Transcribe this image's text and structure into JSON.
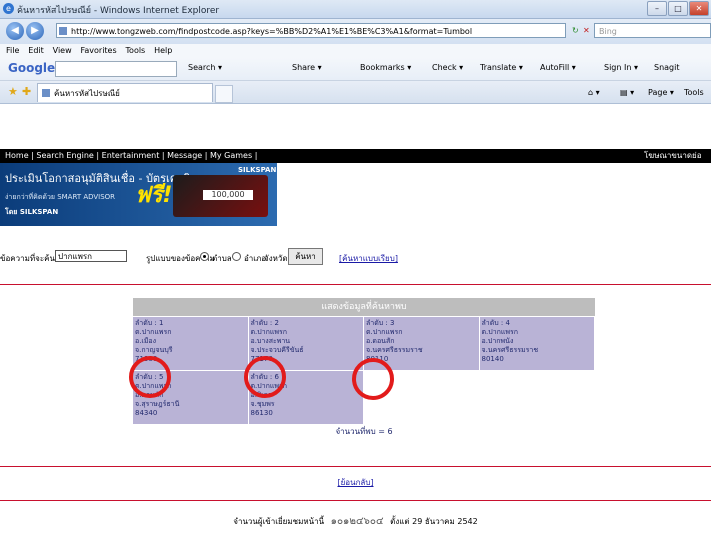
{
  "window": {
    "title": "ค้นหารหัสไปรษณีย์ - Windows Internet Explorer",
    "url": "http://www.tongzweb.com/findpostcode.asp?keys=%BB%D2%A1%E1%BE%C3%A1&format=Tumbol",
    "search_placeholder": "Bing"
  },
  "menu": [
    "File",
    "Edit",
    "View",
    "Favorites",
    "Tools",
    "Help"
  ],
  "google_bar": {
    "logo": "Google",
    "items": [
      "Search ▾",
      "Share ▾",
      "Bookmarks ▾",
      "Check ▾",
      "Translate ▾",
      "AutoFill ▾",
      "Sign In ▾",
      "Snagit"
    ]
  },
  "tab": {
    "label": "ค้นหารหัสไปรษณีย์",
    "tools": [
      "Page ▾",
      "Tools"
    ]
  },
  "site_nav": {
    "links": "Home | Search Engine | Entertainment | Message | My Games |",
    "right": "โฆษณาขนาดย่อ"
  },
  "banner": {
    "headline": "ประเมินโอกาสอนุมัติสินเชื่อ - บัตรเครดิต",
    "sub": "ง่ายกว่าที่คิดด้วย SMART ADVISOR",
    "brand": "โดย SILKSPAN",
    "free": "ฟรี!",
    "logo": "SILKSPAN",
    "amount": "100,000"
  },
  "search_form": {
    "label": "ข้อความที่จะค้นหา",
    "value": "ปากแพรก",
    "option_label": "รูปแบบของข้อความ",
    "options": [
      "ตำบล",
      "อำเภอ",
      "จังหวัด"
    ],
    "button": "ค้นหา",
    "link": "[ค้นหาแบบเรียบ]"
  },
  "results": {
    "header": "แสดงข้อมูลที่ค้นหาพบ",
    "items": [
      {
        "no": "ลำดับ : 1",
        "tambon": "ต.ปากแพรก",
        "amphoe": "อ.เมือง",
        "province": "จ.กาญจนบุรี",
        "code": "71000"
      },
      {
        "no": "ลำดับ : 2",
        "tambon": "ต.ปากแพรก",
        "amphoe": "อ.บางสะพาน",
        "province": "จ.ประจวบคีรีขันธ์",
        "code": "77170"
      },
      {
        "no": "ลำดับ : 3",
        "tambon": "ต.ปากแพรก",
        "amphoe": "อ.ดอนสัก",
        "province": "จ.นครศรีธรรมราช",
        "code": "80110"
      },
      {
        "no": "ลำดับ : 4",
        "tambon": "ต.ปากแพรก",
        "amphoe": "อ.ปากพนัง",
        "province": "จ.นครศรีธรรมราช",
        "code": "80140"
      },
      {
        "no": "ลำดับ : 5",
        "tambon": "ต.ปากแพรก",
        "amphoe": "อ.ดอนสัก",
        "province": "จ.สุราษฎร์ธานี",
        "code": "84340"
      },
      {
        "no": "ลำดับ : 6",
        "tambon": "ต.ปากแพรก",
        "amphoe": "อ.สิเกา",
        "province": "จ.ชุมพร",
        "code": "86130"
      }
    ],
    "count": "จำนวนที่พบ = 6"
  },
  "back_link": "[ย้อนกลับ]",
  "footer": {
    "label": "จำนวนผู้เข้าเยี่ยมชมหน้านี้",
    "counter": "๑๐๑๒๔๖๐๔",
    "since": "ตั้งแต่ 29 ธันวาคม 2542"
  },
  "colors": {
    "highlight": "#e21b1b",
    "result_cell": "#b9b3d6",
    "result_header": "#bdbdbd"
  }
}
